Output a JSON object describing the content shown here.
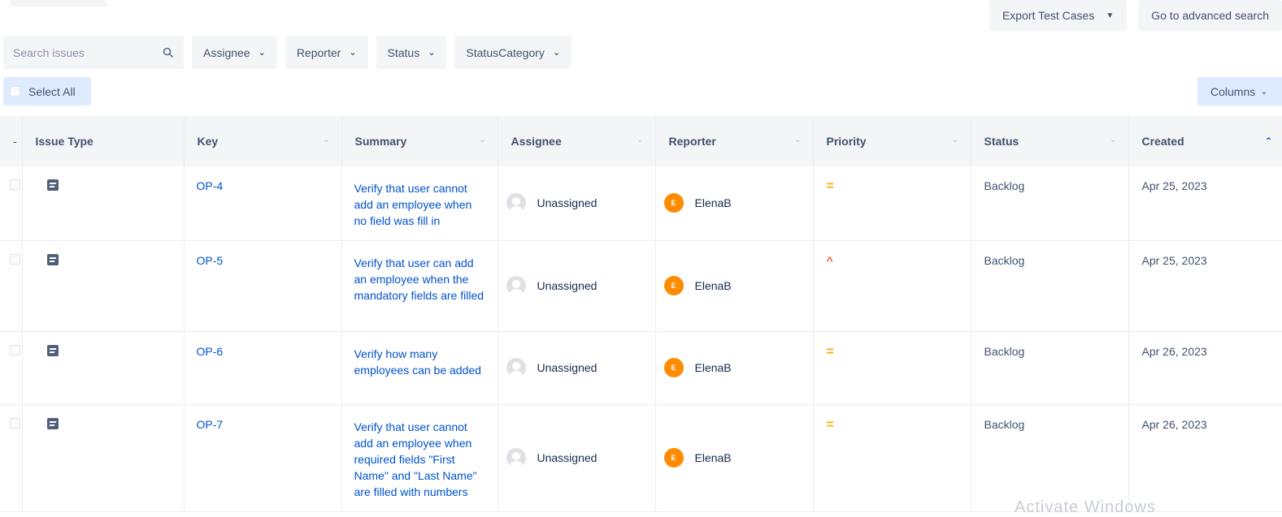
{
  "top_actions": {
    "export_label": "Export Test Cases",
    "advanced_label": "Go to advanced search"
  },
  "filters": {
    "search_placeholder": "Search issues",
    "assignee": "Assignee",
    "reporter": "Reporter",
    "status": "Status",
    "status_category": "StatusCategory"
  },
  "select_all_label": "Select All",
  "columns_label": "Columns",
  "table": {
    "headers": {
      "select": "-",
      "issue_type": "Issue Type",
      "key": "Key",
      "summary": "Summary",
      "assignee": "Assignee",
      "reporter": "Reporter",
      "priority": "Priority",
      "status": "Status",
      "created": "Created"
    },
    "rows": [
      {
        "key": "OP-4",
        "summary": "Verify that user cannot add an employee when no field was fill in",
        "assignee": "Unassigned",
        "reporter": "ElenaB",
        "reporter_initial": "E",
        "priority": "medium",
        "priority_glyph": "=",
        "status": "Backlog",
        "created": "Apr 25, 2023"
      },
      {
        "key": "OP-5",
        "summary": "Verify that user can add an employee when the mandatory fields are filled",
        "assignee": "Unassigned",
        "reporter": "ElenaB",
        "reporter_initial": "E",
        "priority": "high",
        "priority_glyph": "^",
        "status": "Backlog",
        "created": "Apr 25, 2023"
      },
      {
        "key": "OP-6",
        "summary": "Verify how many employees can be added",
        "assignee": "Unassigned",
        "reporter": "ElenaB",
        "reporter_initial": "E",
        "priority": "medium",
        "priority_glyph": "=",
        "status": "Backlog",
        "created": "Apr 26, 2023"
      },
      {
        "key": "OP-7",
        "summary": "Verify that user cannot add an employee when required fields \"First Name\" and \"Last Name\" are filled with numbers",
        "assignee": "Unassigned",
        "reporter": "ElenaB",
        "reporter_initial": "E",
        "priority": "medium",
        "priority_glyph": "=",
        "status": "Backlog",
        "created": "Apr 26, 2023"
      }
    ]
  },
  "watermark": "Activate Windows",
  "colors": {
    "link": "#0052cc",
    "medium_priority": "#ffab00",
    "high_priority": "#ff5630",
    "avatar": "#ff8b00"
  }
}
